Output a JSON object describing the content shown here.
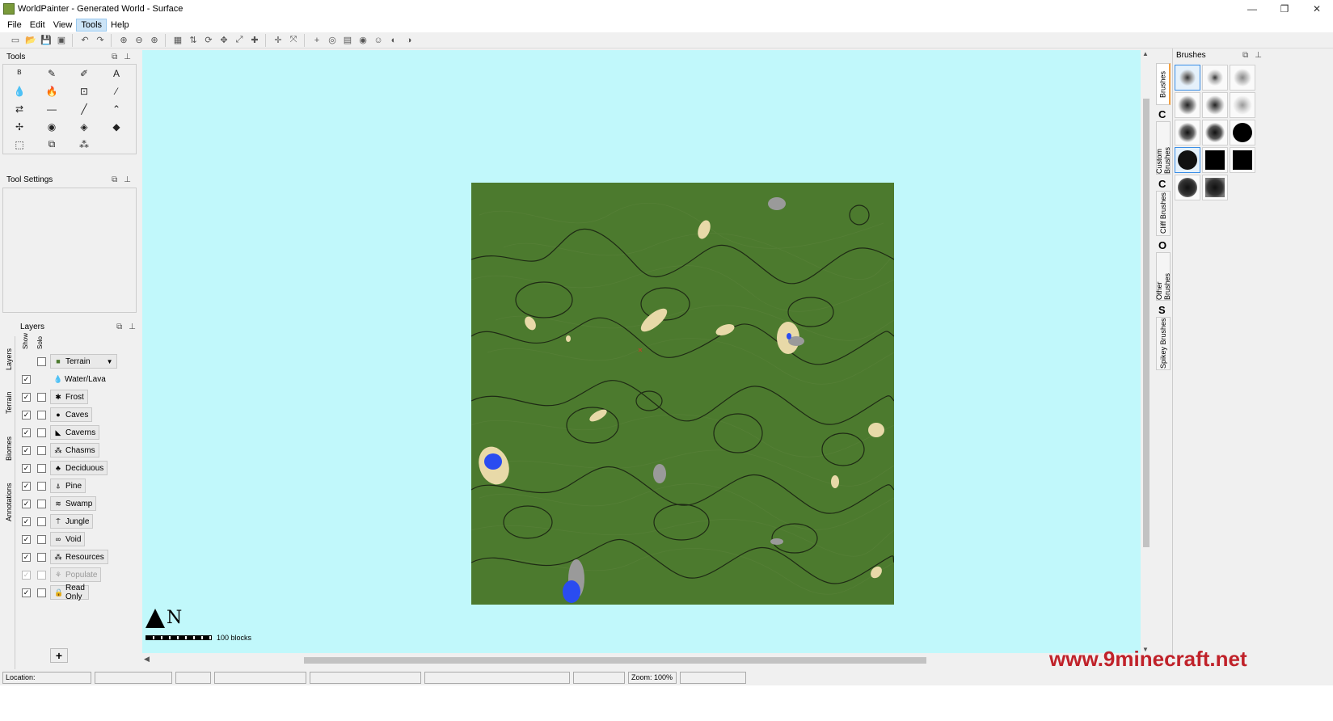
{
  "window": {
    "title": "WorldPainter - Generated World - Surface",
    "minimize": "—",
    "maximize": "❐",
    "close": "✕"
  },
  "menu": [
    {
      "label": "File"
    },
    {
      "label": "Edit"
    },
    {
      "label": "View"
    },
    {
      "label": "Tools",
      "active": true
    },
    {
      "label": "Help"
    }
  ],
  "toolbar": {
    "icons": [
      "new-icon",
      "open-icon",
      "save-icon",
      "export-icon",
      "sep",
      "undo-icon",
      "redo-icon",
      "sep",
      "zoom-reset-icon",
      "zoom-out-icon",
      "zoom-in-icon",
      "sep",
      "grid-icon",
      "contours-icon",
      "rotate-icon",
      "shift-icon",
      "scale-icon",
      "mods-icon",
      "sep",
      "spawn-icon",
      "move-icon",
      "sep",
      "crosshair-icon",
      "view-target-icon",
      "image-icon",
      "view-3d-icon",
      "person-icon",
      "globe-icon",
      "biome-icon"
    ]
  },
  "tools_panel": {
    "title": "Tools"
  },
  "tools": [
    "flood-icon",
    "pencil-icon",
    "spray-icon",
    "text-icon",
    "water-icon",
    "lava-icon",
    "sponge-icon",
    "eyedropper-icon",
    "smooth-icon",
    "flatten-icon",
    "slope-icon",
    "raise-mountain-icon",
    "ridge-icon",
    "pyramid-icon",
    "set-height-icon",
    "lower-icon",
    "select-icon",
    "copy-icon",
    "clear-selection-icon"
  ],
  "tool_glyphs": [
    "ᴮ",
    "✎",
    "✐",
    "A",
    "💧",
    "🔥",
    "⊡",
    "⁄",
    "⇄",
    "—",
    "╱",
    "⌃",
    "✢",
    "◉",
    "◈",
    "◆",
    "⬚",
    "⧉",
    "⁂"
  ],
  "tool_settings": {
    "title": "Tool Settings"
  },
  "layers_panel": {
    "title": "Layers",
    "col_show": "Show",
    "col_solo": "Solo",
    "vtabs": [
      "Layers",
      "Terrain",
      "Biomes",
      "Annotations"
    ],
    "items": [
      {
        "label": "Terrain",
        "icon": "terrain-icon",
        "glyph": "■",
        "show": null,
        "solo": false,
        "dropdown": true
      },
      {
        "label": "Water/Lava",
        "icon": "water-drop-icon",
        "glyph": "💧",
        "show": true,
        "solo": null,
        "plain": true
      },
      {
        "label": "Frost",
        "icon": "frost-icon",
        "glyph": "✱",
        "show": true,
        "solo": false
      },
      {
        "label": "Caves",
        "icon": "caves-icon",
        "glyph": "●",
        "show": true,
        "solo": false
      },
      {
        "label": "Caverns",
        "icon": "caverns-icon",
        "glyph": "◣",
        "show": true,
        "solo": false
      },
      {
        "label": "Chasms",
        "icon": "chasms-icon",
        "glyph": "⁂",
        "show": true,
        "solo": false
      },
      {
        "label": "Deciduous",
        "icon": "deciduous-tree-icon",
        "glyph": "♣",
        "show": true,
        "solo": false
      },
      {
        "label": "Pine",
        "icon": "pine-tree-icon",
        "glyph": "⍋",
        "show": true,
        "solo": false
      },
      {
        "label": "Swamp",
        "icon": "swamp-icon",
        "glyph": "≋",
        "show": true,
        "solo": false
      },
      {
        "label": "Jungle",
        "icon": "jungle-icon",
        "glyph": "⍑",
        "show": true,
        "solo": false
      },
      {
        "label": "Void",
        "icon": "void-icon",
        "glyph": "∞",
        "show": true,
        "solo": false
      },
      {
        "label": "Resources",
        "icon": "resources-icon",
        "glyph": "⁂",
        "show": true,
        "solo": false
      },
      {
        "label": "Populate",
        "icon": "populate-icon",
        "glyph": "⚘",
        "show": true,
        "solo": false,
        "disabled": true
      },
      {
        "label": "Read Only",
        "icon": "lock-icon",
        "glyph": "🔒",
        "show": true,
        "solo": false
      }
    ],
    "add_label": "+"
  },
  "canvas": {
    "compass_letter": "N",
    "scale_label": "100 blocks",
    "background": "#c1f8fb",
    "world_color": "#4c7a2e"
  },
  "brushes_panel": {
    "title": "Brushes",
    "tabs": [
      {
        "letter": "",
        "label": "Brushes",
        "active": true
      },
      {
        "letter": "C",
        "label": "Custom Brushes"
      },
      {
        "letter": "C",
        "label": "Cliff Brushes"
      },
      {
        "letter": "O",
        "label": "Other Brushes"
      },
      {
        "letter": "S",
        "label": "Spikey Brushes"
      }
    ]
  },
  "status": {
    "location": "Location:",
    "zoom": "Zoom: 100%"
  },
  "watermark": "www.9minecraft.net",
  "colors": {
    "accent": "#f4a040",
    "selected": "#cce4f7",
    "watermark": "#c0222a"
  }
}
